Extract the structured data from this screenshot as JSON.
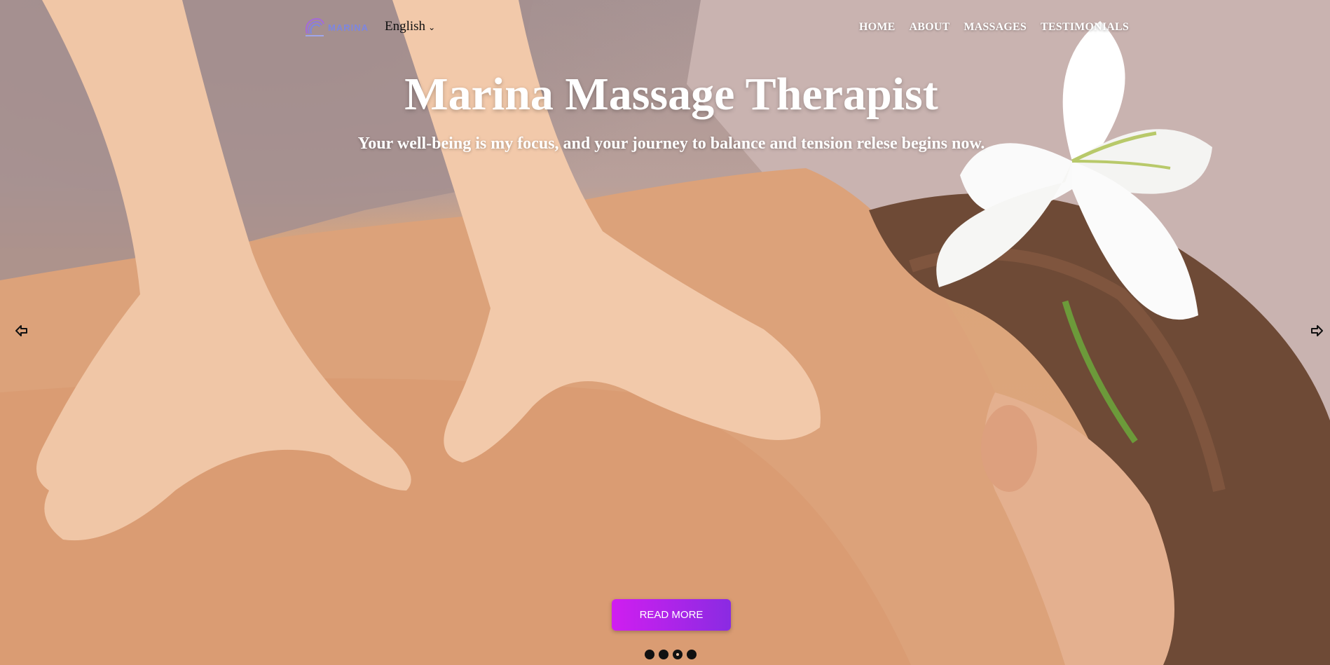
{
  "logo": {
    "text": "MARINA"
  },
  "language": {
    "selected": "English",
    "icon": "chevron-down-icon"
  },
  "nav": {
    "items": [
      {
        "label": "HOME"
      },
      {
        "label": "ABOUT"
      },
      {
        "label": "MASSAGES"
      },
      {
        "label": "TESTIMONIALS"
      }
    ]
  },
  "hero": {
    "title": "Marina Massage Therapist",
    "subtitle": "Your well-being is my focus, and your journey to balance and tension relese begins now.",
    "cta_label": "READ MORE"
  },
  "carousel": {
    "prev_icon": "arrow-left-icon",
    "next_icon": "arrow-right-icon",
    "slide_count": 4,
    "active_slide": 3
  },
  "colors": {
    "cta_start": "#d01ef0",
    "cta_end": "#8a2be2",
    "logo_accent": "#7d86e0",
    "nav_text": "#ffffff"
  }
}
